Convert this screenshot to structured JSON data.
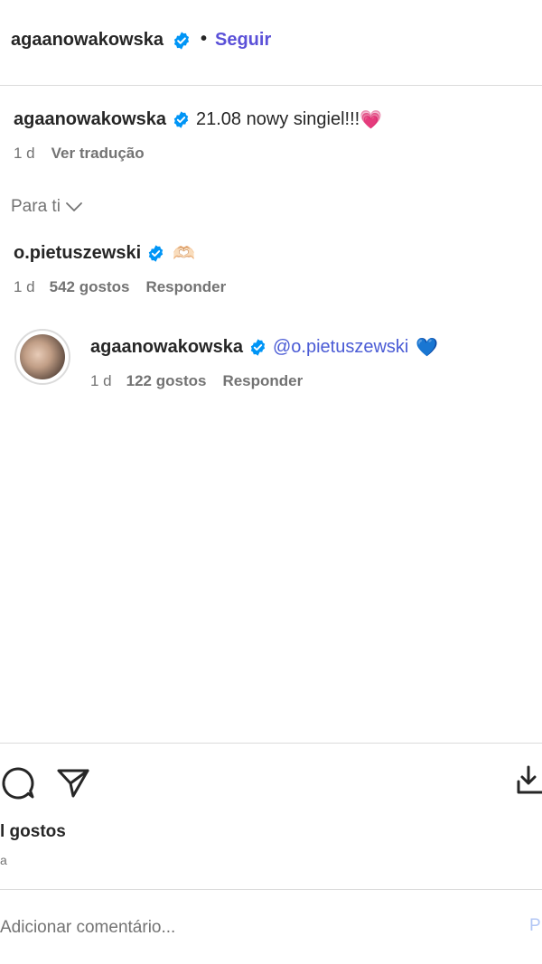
{
  "header": {
    "username": "agaanowakowska",
    "dot": "•",
    "follow_label": "Seguir"
  },
  "caption": {
    "username": "agaanowakowska",
    "text": "21.08 nowy singiel!!!",
    "emoji": "💗",
    "time": "1 d",
    "translate_label": "Ver tradução"
  },
  "filter": {
    "label": "Para ti"
  },
  "comments": [
    {
      "username": "o.pietuszewski",
      "emoji": "🫶🏻",
      "time": "1 d",
      "likes": "542 gostos",
      "reply_label": "Responder"
    }
  ],
  "reply": {
    "username": "agaanowakowska",
    "mention": "@o.pietuszewski",
    "emoji": "💙",
    "time": "1 d",
    "likes": "122 gostos",
    "reply_label": "Responder"
  },
  "post": {
    "likes_label": "l gostos",
    "sub_label": "a"
  },
  "comment_box": {
    "placeholder": "Adicionar comentário...",
    "publish_label": "P"
  },
  "colors": {
    "verified": "#0095f6",
    "link": "#5b51d8",
    "muted": "#737373",
    "border": "#dbdbdb"
  }
}
